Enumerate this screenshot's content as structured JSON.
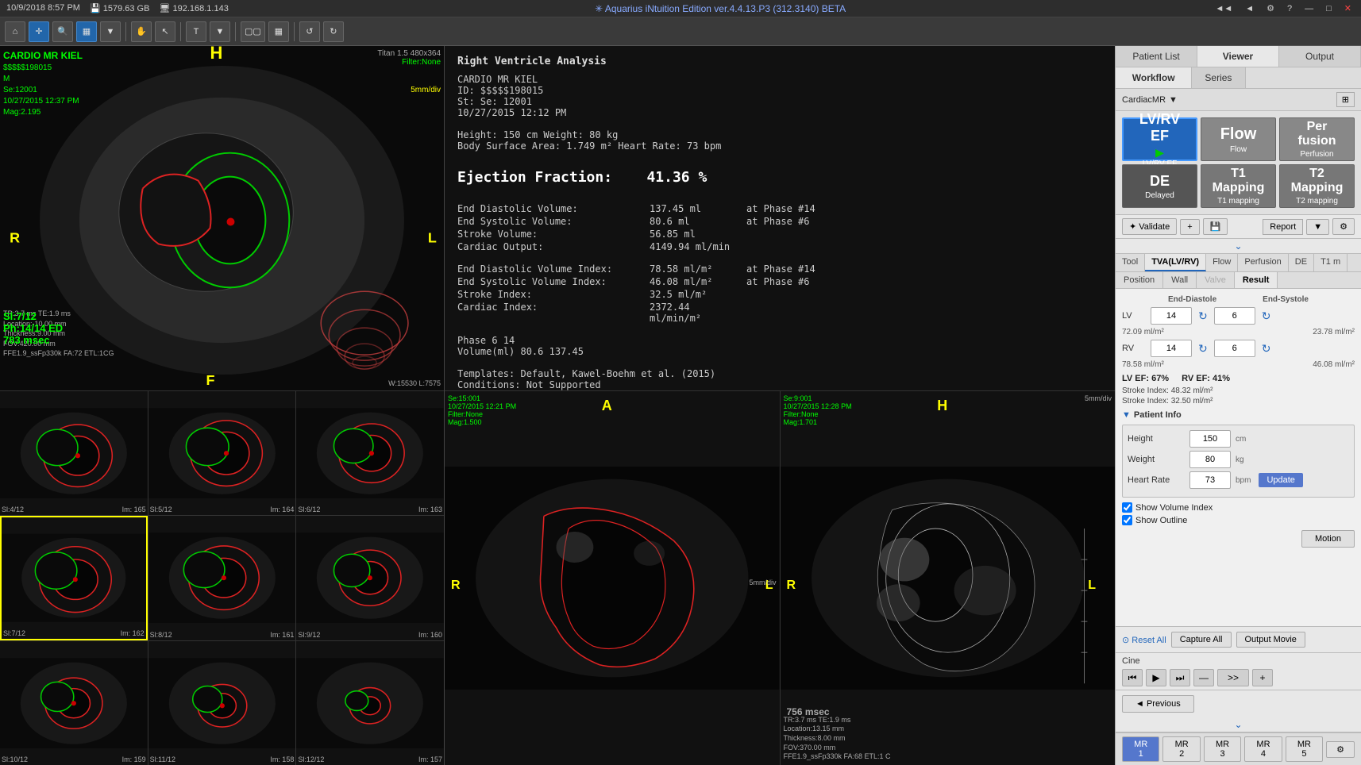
{
  "topbar": {
    "datetime": "10/9/2018  8:57 PM",
    "disk": "1579.63 GB",
    "ip": "192.168.1.143",
    "title": "✳ Aquarius iNtuition Edition ver.4.4.13.P3 (312.3140) BETA",
    "btn_back": "◄◄",
    "btn_fwd": "◄",
    "btn_settings": "⚙",
    "btn_help": "?",
    "btn_minimize": "—",
    "btn_maximize": "□",
    "btn_close": "✕"
  },
  "toolbar": {
    "buttons": [
      "◎",
      "↔",
      "🔍",
      "🔲",
      "▶",
      "T",
      "□□",
      "▦",
      "↺",
      "↻"
    ]
  },
  "right_panel": {
    "tabs": [
      "Patient List",
      "Viewer",
      "Output"
    ],
    "active_tab": "Viewer",
    "subtabs": [
      "Workflow",
      "Series"
    ],
    "active_subtab": "Workflow",
    "cardiacmr_label": "CardiacMR",
    "workflow_buttons": [
      {
        "id": "lvrv_ef",
        "icon": "LV/RV\nEF",
        "label": "LV/RV EF",
        "active": true
      },
      {
        "id": "flow",
        "icon": "Flow",
        "label": "Flow",
        "active": false
      },
      {
        "id": "perfusion",
        "icon": "Per\nfusion",
        "label": "Perfusion",
        "active": false
      },
      {
        "id": "de",
        "icon": "DE",
        "label": "Delayed",
        "active": false
      },
      {
        "id": "t1map",
        "icon": "T1\nMapping",
        "label": "T1 mapping",
        "active": false
      },
      {
        "id": "t2map",
        "icon": "T2\nMapping",
        "label": "T2 mapping",
        "active": false
      }
    ],
    "validate_label": "✦ Validate",
    "plus_label": "+",
    "save_label": "💾",
    "report_label": "Report",
    "analysis_tabs": [
      "Tool",
      "TVA(LV/RV)",
      "Flow",
      "Perfusion",
      "DE",
      "T1 m"
    ],
    "active_analysis_tab": "TVA(LV/RV)",
    "result_tabs": [
      "Position",
      "Wall",
      "Valve",
      "Result"
    ],
    "active_result_tab": "Result",
    "result": {
      "headers": [
        "End-Diastole",
        "End-Systole"
      ],
      "lv_label": "LV",
      "rv_label": "RV",
      "lv_ed_value": "14",
      "lv_es_value": "6",
      "rv_ed_value": "14",
      "rv_es_value": "6",
      "lv_ed_ml": "72.09 ml/m²",
      "lv_es_ml": "23.78 ml/m²",
      "rv_ed_ml": "78.58 ml/m²",
      "rv_es_ml": "46.08 ml/m²",
      "lv_ef_label": "LV EF: 67%",
      "rv_ef_label": "RV EF: 41%",
      "lv_stroke": "Stroke Index: 48.32 ml/m²",
      "rv_stroke": "Stroke Index: 32.50 ml/m²"
    },
    "patient_info": {
      "title": "Patient Info",
      "height_label": "Height",
      "height_value": "150",
      "height_unit": "cm",
      "weight_label": "Weight",
      "weight_value": "80",
      "weight_unit": "kg",
      "hr_label": "Heart Rate",
      "hr_value": "73",
      "hr_unit": "bpm",
      "update_label": "Update"
    },
    "show_volume_index": "Show Volume Index",
    "show_outline": "Show Outline",
    "motion_label": "Motion",
    "reset_label": "⊙ Reset All",
    "capture_label": "Capture All",
    "output_movie_label": "Output Movie",
    "cine_label": "Cine",
    "cine_btns": [
      "⏮",
      "▶",
      "⏭",
      "—",
      "⏩⏩",
      "+"
    ],
    "previous_label": "◄ Previous",
    "bottom_nav": [
      "MR 1",
      "MR 2",
      "MR 3",
      "MR 4",
      "MR 5"
    ]
  },
  "main_image": {
    "title": "CARDIO MR KIEL",
    "id": "$$$$$198015",
    "sex": "M",
    "series": "Se:12001",
    "date": "10/27/2015  12:37 PM",
    "mag": "Mag:2.195",
    "filter": "Filter:None",
    "scanner": "Titan 1.5\n480x364",
    "slice": "Sl:7/12",
    "phase": "Ph:14/14 ED",
    "time": "783 msec",
    "tech_info": "TR:3.7 ms TE:1.9 ms\nLocation:-10.00 mm\nThickness:9.00 mm\nFOV:420.00 mm\nFFE1.9_ssFp330k FA:72 ETL:1CG",
    "label_h": "H",
    "label_r": "R",
    "label_l": "L",
    "label_f": "F",
    "w_l": "W:15530 L:7575"
  },
  "analysis_report": {
    "title": "Right Ventricle Analysis",
    "patient": "CARDIO MR KIEL",
    "id": "ID: $$$$$198015",
    "st": "St:  Se: 12001",
    "date": "10/27/2015   12:12 PM",
    "height": "Height: 150 cm  Weight: 80 kg",
    "bsa": "Body Surface Area: 1.749 m²   Heart Rate: 73 bpm",
    "ef_label": "Ejection Fraction:",
    "ef_value": "41.36 %",
    "edv_label": "End Diastolic Volume:",
    "edv_value": "137.45 ml",
    "edv_phase": "at Phase #14",
    "esv_label": "End Systolic Volume:",
    "esv_value": "80.6  ml",
    "esv_phase": "at Phase #6",
    "sv_label": "Stroke Volume:",
    "sv_value": "56.85 ml",
    "co_label": "Cardiac Output:",
    "co_value": "4149.94 ml/min",
    "edvi_label": "End Diastolic Volume Index:",
    "edvi_value": "78.58 ml/m²",
    "edvi_phase": "at Phase #14",
    "esvi_label": "End Systolic Volume Index:",
    "esvi_value": "46.08 ml/m²",
    "esvi_phase": "at Phase #6",
    "si_label": "Stroke Index:",
    "si_value": "32.5  ml/m²",
    "ci_label": "Cardiac Index:",
    "ci_value": "2372.44 ml/min/m²",
    "phase_row": "Phase       6     14",
    "volume_row": "Volume(ml)  80.6   137.45",
    "templates": "Templates: Default, Kawel-Boehm et al. (2015)",
    "conditions": "Conditions: Not Supported"
  },
  "thumbnails": [
    {
      "slice": "Sl:4/12",
      "im": "Im: 165"
    },
    {
      "slice": "Sl:5/12",
      "im": "Im: 164"
    },
    {
      "slice": "Sl:6/12",
      "im": "Im: 163"
    },
    {
      "slice": "Sl:7/12",
      "im": "Im: 162",
      "selected": true
    },
    {
      "slice": "Sl:8/12",
      "im": "Im: 161"
    },
    {
      "slice": "Sl:9/12",
      "im": "Im: 160"
    },
    {
      "slice": "Sl:10/12",
      "im": "Im: 159"
    },
    {
      "slice": "Sl:11/12",
      "im": "Im: 158"
    },
    {
      "slice": "Sl:12/12",
      "im": "Im: 157"
    }
  ],
  "bottom_images": [
    {
      "series": "Se:15:001",
      "date": "10/27/2015 12:21 PM",
      "filter": "Filter:None",
      "mag": "Mag:1.500",
      "label_a": "A",
      "label_r": "R",
      "label_l": "L"
    },
    {
      "series": "Se:9:001",
      "date": "10/27/2015 12:28 PM",
      "filter": "Filter:None",
      "mag": "Mag:1.701",
      "label_h": "H",
      "label_r": "R",
      "label_l": "L",
      "time": "756 msec",
      "tech": "TR:3.7 ms TE:1.9 ms\nLocation:13.15 mm\nThickness:8.00 mm\nFOV:370.00 mm\nFFE1.9_ssFp330k FA:68 ETL:1 C"
    }
  ]
}
